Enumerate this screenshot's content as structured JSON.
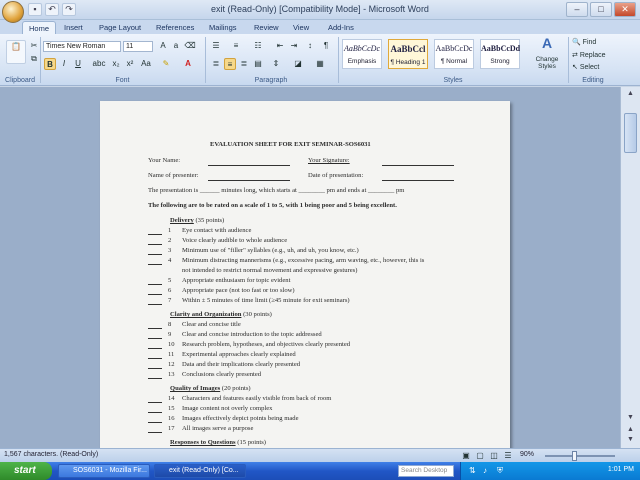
{
  "window": {
    "title": "exit (Read-Only) [Compatibility Mode] - Microsoft Word"
  },
  "tabs": [
    "Home",
    "Insert",
    "Page Layout",
    "References",
    "Mailings",
    "Review",
    "View",
    "Add-Ins"
  ],
  "ribbon": {
    "font_name": "Times New Roman",
    "font_size": "11",
    "groups": {
      "clipboard": "Clipboard",
      "font": "Font",
      "paragraph": "Paragraph",
      "styles": "Styles",
      "editing": "Editing"
    },
    "styles": [
      {
        "sample": "AaBbCcDc",
        "name": "Emphasis"
      },
      {
        "sample": "AaBbCcl",
        "name": "¶ Heading 1"
      },
      {
        "sample": "AaBbCcDc",
        "name": "¶ Normal"
      },
      {
        "sample": "AaBbCcDd",
        "name": "Strong"
      }
    ],
    "change_styles": "Change Styles",
    "editing": {
      "find": "Find",
      "replace": "Replace",
      "select": "Select"
    }
  },
  "document": {
    "title": "EVALUATION SHEET FOR EXIT SEMINAR-SOS6031",
    "your_name": "Your Name:",
    "your_signature": "Your Signature:",
    "name_of_presenter": "Name of presenter:",
    "date_of_presentation": "Date of presentation:",
    "presentation_line": "The presentation is ______ minutes long, which starts at ________ pm and ends at ________ pm",
    "rating_instruction": "The following are to be rated on a scale of 1 to 5, with 1 being poor and 5 being excellent.",
    "sections": [
      {
        "heading": "Delivery",
        "points": "(35 points)",
        "items": [
          {
            "n": "1",
            "text": "Eye contact with audience"
          },
          {
            "n": "2",
            "text": "Voice clearly audible to whole audience"
          },
          {
            "n": "3",
            "text": "Minimum use of \"filler\" syllables (e.g., uh, and uh, you know, etc.)"
          },
          {
            "n": "4",
            "text": "Minimum distracting mannerisms (e.g., excessive pacing, arm waving, etc., however, this is"
          },
          {
            "n": "",
            "text": "not intended to restrict normal movement and expressive gestures)"
          },
          {
            "n": "5",
            "text": "Appropriate enthusiasm for topic evident"
          },
          {
            "n": "6",
            "text": "Appropriate pace (not too fast or too slow)"
          },
          {
            "n": "7",
            "text": "Within ± 5 minutes of time limit (≥45 minute for exit seminars)"
          }
        ]
      },
      {
        "heading": "Clarity and Organization",
        "points": "(30 points)",
        "items": [
          {
            "n": "8",
            "text": "Clear and concise title"
          },
          {
            "n": "9",
            "text": "Clear and concise introduction to the topic addressed"
          },
          {
            "n": "10",
            "text": "Research problem, hypotheses, and objectives clearly presented"
          },
          {
            "n": "11",
            "text": "Experimental approaches clearly explained"
          },
          {
            "n": "12",
            "text": "Data and their implications clearly presented"
          },
          {
            "n": "13",
            "text": "Conclusions clearly presented"
          }
        ]
      },
      {
        "heading": "Quality of Images",
        "points": "(20 points)",
        "items": [
          {
            "n": "14",
            "text": "Characters and features easily visible from back of room"
          },
          {
            "n": "15",
            "text": "Image content not overly complex"
          },
          {
            "n": "16",
            "text": "Images effectively depict points being made"
          },
          {
            "n": "17",
            "text": "All images serve a purpose"
          }
        ]
      },
      {
        "heading": "Responses to Questions",
        "points": "(15 points)",
        "items": []
      }
    ]
  },
  "status": {
    "text": "1,567 characters. (Read-Only)",
    "zoom": "90%"
  },
  "taskbar": {
    "start": "start",
    "items": [
      "SOS6031 - Mozilla Fir...",
      "exit (Read-Only) [Co..."
    ],
    "search_placeholder": "Search Desktop",
    "clock": "1:01 PM"
  }
}
